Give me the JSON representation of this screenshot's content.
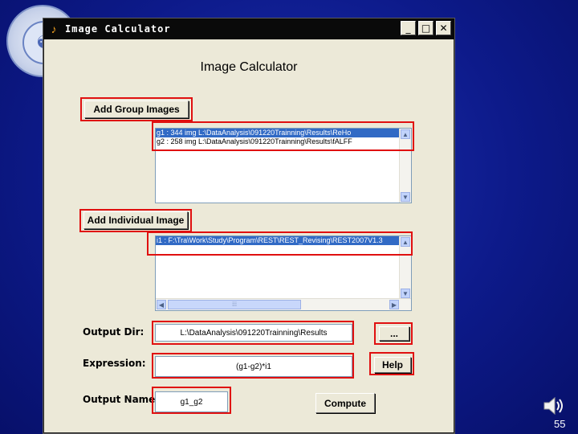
{
  "window": {
    "title": "Image Calculator",
    "app_icon": "matlab-icon",
    "minimize_glyph": "_",
    "maximize_glyph": "□",
    "close_glyph": "✕"
  },
  "heading": "Image Calculator",
  "group": {
    "button_label": "Add Group Images",
    "items": [
      "g1 : 344 img L:\\DataAnalysis\\091220Trainning\\Results\\ReHo",
      "g2 : 258 img L:\\DataAnalysis\\091220Trainning\\Results\\fALFF"
    ]
  },
  "individual": {
    "button_label": "Add Individual Image",
    "items": [
      "i1 : F:\\Tra\\Work\\Study\\Program\\REST\\REST_Revising\\REST2007V1.3"
    ]
  },
  "output_dir": {
    "label": "Output Dir:",
    "value": "L:\\DataAnalysis\\091220Trainning\\Results",
    "browse_label": "..."
  },
  "expression": {
    "label": "Expression:",
    "value": "(g1-g2)*i1",
    "help_label": "Help"
  },
  "output_name": {
    "label": "Output Name:",
    "value": "g1_g2",
    "compute_label": "Compute"
  },
  "slide": {
    "page_number": "55"
  },
  "colors": {
    "highlight": "#e01010",
    "selection": "#316ac5"
  }
}
